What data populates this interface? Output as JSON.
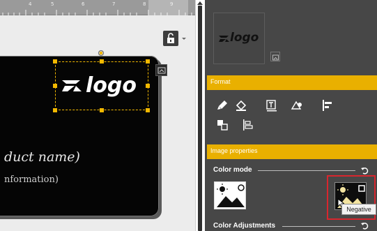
{
  "ruler": {
    "labels": [
      "4",
      "5",
      "6",
      "7",
      "8",
      "9"
    ]
  },
  "canvas": {
    "logo_text": "logo",
    "product_text": "duct name)",
    "info_text": "nformation)"
  },
  "panel": {
    "thumbnail_logo_text": "logo",
    "format_label": "Format",
    "image_properties_label": "Image properties",
    "color_mode_label": "Color mode",
    "color_adjustments_label": "Color Adjustments",
    "tooltip_text": "Negative"
  },
  "colors": {
    "accent": "#e9b000",
    "selection": "#f2b800",
    "highlight": "#d8262e",
    "panel_bg": "#474747"
  },
  "icons": [
    "lock-icon",
    "chevron-down-icon",
    "rotate-icon",
    "frame-icon",
    "brush-icon",
    "fill-icon",
    "text-icon",
    "shape-icon",
    "align-left-icon",
    "arrange-icon",
    "distribute-icon",
    "reset-icon",
    "image-icon"
  ]
}
